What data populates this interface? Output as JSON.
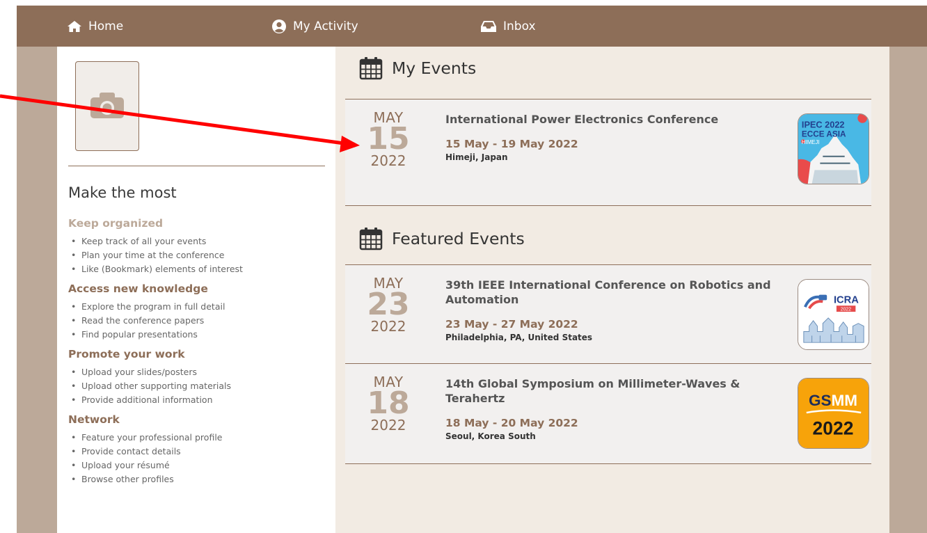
{
  "nav": {
    "home": "Home",
    "activity": "My Activity",
    "inbox": "Inbox"
  },
  "sidebar": {
    "title": "Make the most",
    "sections": [
      {
        "title": "Keep organized",
        "items": [
          "Keep track of all your events",
          "Plan your time at the conference",
          "Like (Bookmark) elements of interest"
        ]
      },
      {
        "title": "Access new knowledge",
        "items": [
          "Explore the program in full detail",
          "Read the conference papers",
          "Find popular presentations"
        ]
      },
      {
        "title": "Promote your work",
        "items": [
          "Upload your slides/posters",
          "Upload other supporting materials",
          "Provide additional information"
        ]
      },
      {
        "title": "Network",
        "items": [
          "Feature your professional profile",
          "Provide contact details",
          "Upload your résumé",
          "Browse other profiles"
        ]
      }
    ]
  },
  "my_events": {
    "title": "My Events",
    "events": [
      {
        "month": "MAY",
        "day": "15",
        "year": "2022",
        "title": "International Power Electronics Conference",
        "dates": "15 May - 19 May 2022",
        "location": "Himeji, Japan",
        "logo": {
          "line1": "IPEC 2022",
          "line2": "ECCE ASIA",
          "line3": "HIMEJI"
        }
      }
    ]
  },
  "featured_events": {
    "title": "Featured Events",
    "events": [
      {
        "month": "MAY",
        "day": "23",
        "year": "2022",
        "title": "39th IEEE International Conference on Robotics and Automation",
        "dates": "23 May - 27 May 2022",
        "location": "Philadelphia, PA, United States",
        "logo": {
          "line1": "ICRA",
          "line2": "2022"
        }
      },
      {
        "month": "MAY",
        "day": "18",
        "year": "2022",
        "title": "14th Global Symposium on Millimeter-Waves & Terahertz",
        "dates": "18 May - 20 May 2022",
        "location": "Seoul, Korea South",
        "logo": {
          "line1a": "GS",
          "line1b": "MM",
          "line2": "2022"
        }
      }
    ]
  },
  "colors": {
    "nav_bg": "#8d6e58",
    "side_bg": "#bca999",
    "main_bg": "#f2ebe3",
    "annotation_arrow": "#ff0000"
  }
}
